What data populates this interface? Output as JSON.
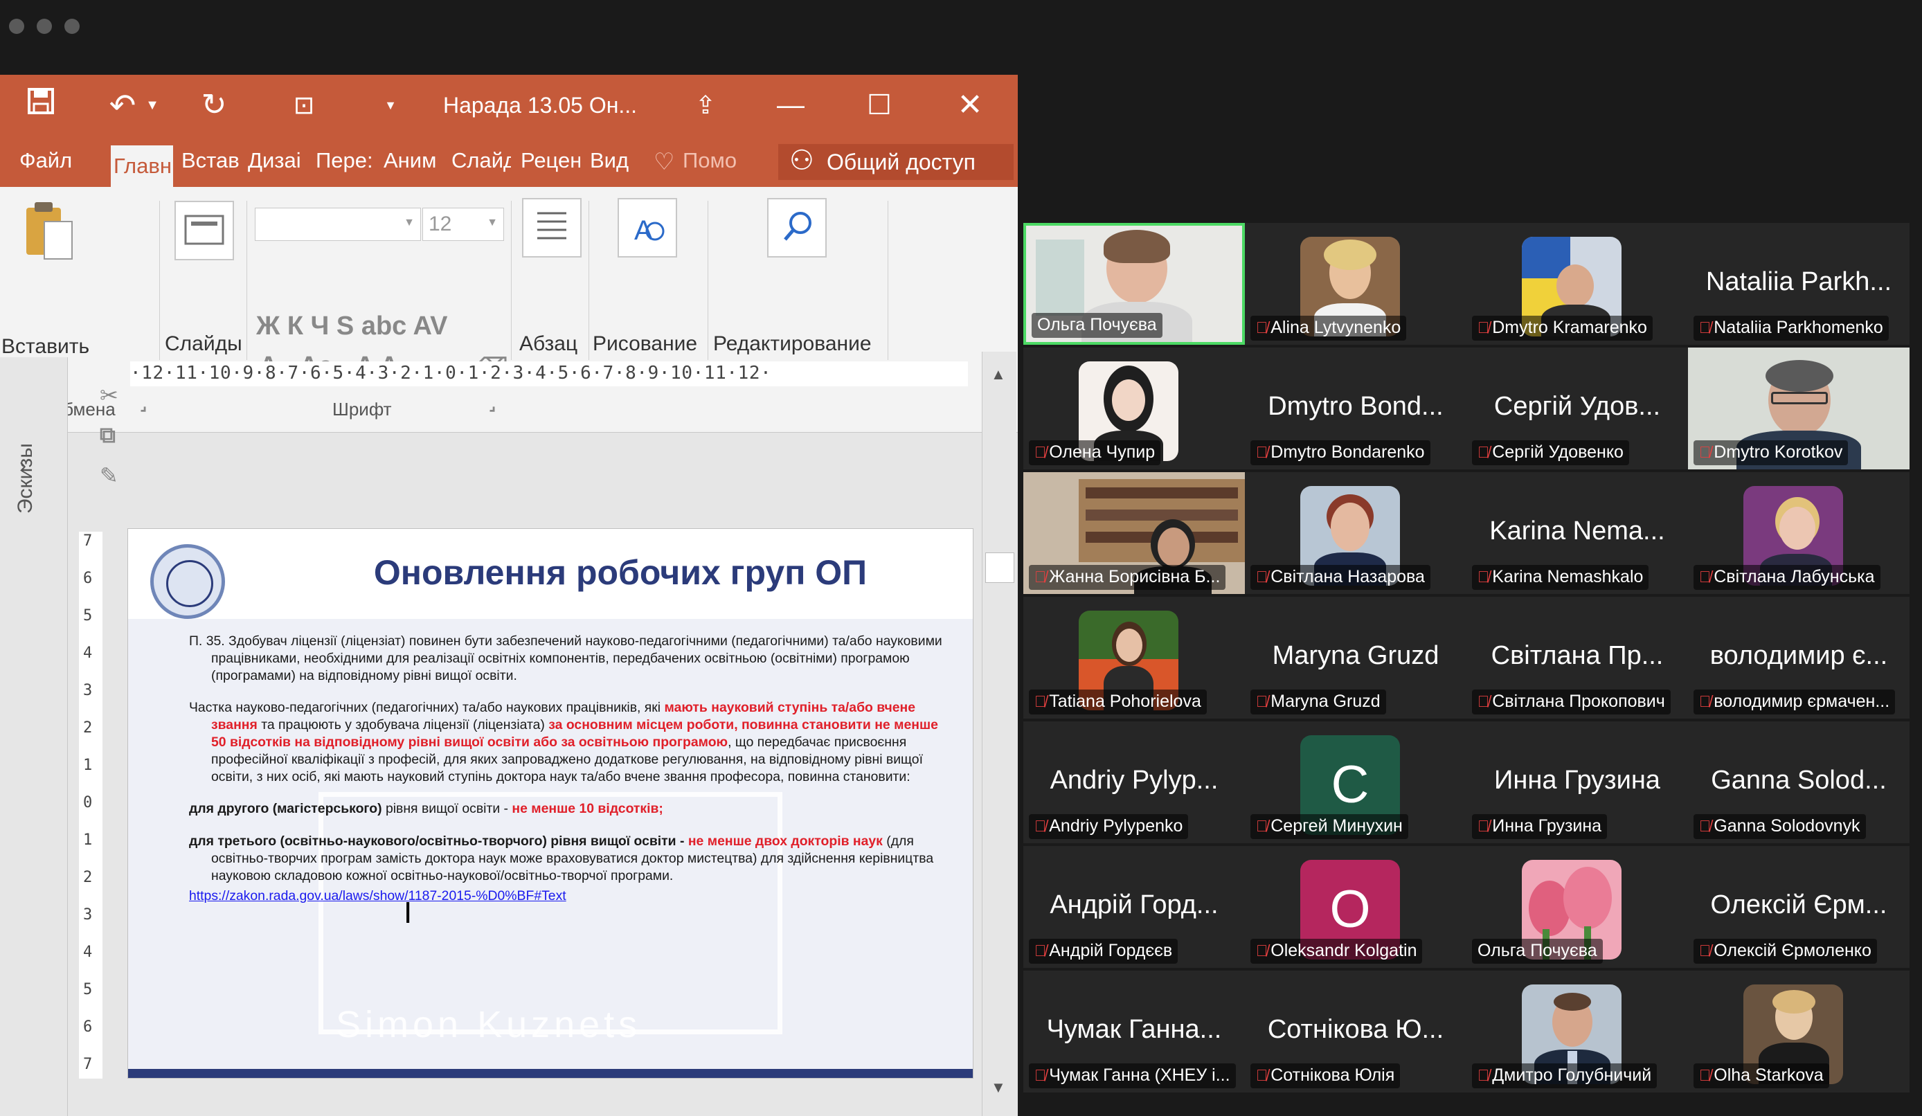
{
  "ppt": {
    "doc_title": "Нарада 13.05 Он...",
    "tabs": [
      "Файл",
      "Главн",
      "Встав",
      "Дизаі",
      "Пере:",
      "Аним",
      "Слайд",
      "Рецен",
      "Вид",
      "Помо"
    ],
    "share": "Общий доступ",
    "ribbon": {
      "paste": "Вставить",
      "slides": "Слайды",
      "paragraph": "Абзац",
      "drawing": "Рисование",
      "editing": "Редактирование",
      "clipboard_group": "Буфер обмена",
      "font_group": "Шрифт",
      "font_size": "12",
      "font_glyphs": "Ж К Ч S abc AV",
      "font_glyphs2": "A · Aa · A A"
    },
    "thumbs_label": "Эскизы",
    "ruler": "·12·11·10·9·8·7·6·5·4·3·2·1·0·1·2·3·4·5·6·7·8·9·10·11·12·",
    "slide": {
      "title": "Оновлення робочих груп ОП",
      "p1": "П. 35. Здобувач ліцензії (ліцензіат) повинен бути забезпечений науково-педагогічними (педагогічними) та/або науковими працівниками, необхідними для реалізації освітніх компонентів, передбачених освітньою (освітніми) програмою (програмами) на відповідному рівні вищої освіти.",
      "p2a": "Частка науково-педагогічних (педагогічних) та/або наукових працівників, які ",
      "p2b": "мають науковий ступінь та/або вчене звання",
      "p2c": " та працюють у здобувача ліцензії (ліцензіата) ",
      "p2d": "за основним місцем роботи, повинна становити не менше 50 відсотків на відповідному рівні вищої освіти або за освітньою програмою",
      "p2e": ", що передбачає присвоєння професійної кваліфікації з професій, для яких запроваджено додаткове регулювання, на відповідному рівні вищої освіти, з них осіб, які мають науковий ступінь доктора наук та/або вчене звання професора, повинна становити:",
      "p3a": "для другого (магістерського)",
      "p3b": " рівня вищої освіти - ",
      "p3c": "не менше 10 відсотків;",
      "p4a": "для третього (освітньо-наукового/освітньо-творчого) рівня вищої освіти - ",
      "p4b": "не менше двох докторів наук",
      "p4c": " (для освітньо-творчих програм замість доктора наук може враховуватися доктор мистецтва) для здійснення керівництва науковою складовою кожної освітньо-наукової/освітньо-творчої програми.",
      "link": "https://zakon.rada.gov.ua/laws/show/1187-2015-%D0%BF#Text",
      "watermark": "Simon Kuznets"
    }
  },
  "participants": [
    {
      "name": "Ольга Почуєва",
      "muted": false,
      "type": "video",
      "active": true
    },
    {
      "name": "Alina Lytvynenko",
      "muted": true,
      "type": "photo"
    },
    {
      "name": "Dmytro Kramarenko",
      "muted": true,
      "type": "photo"
    },
    {
      "name": "Nataliia Parkhomenko",
      "display": "Nataliia Parkh...",
      "muted": true,
      "type": "name"
    },
    {
      "name": "Олена Чупир",
      "muted": true,
      "type": "photo"
    },
    {
      "name": "Dmytro Bondarenko",
      "display": "Dmytro Bond...",
      "muted": true,
      "type": "name"
    },
    {
      "name": "Сергій Удовенко",
      "display": "Сергій Удов...",
      "muted": true,
      "type": "name"
    },
    {
      "name": "Dmytro Korotkov",
      "muted": true,
      "type": "video"
    },
    {
      "name": "Жанна Борисівна Б...",
      "muted": true,
      "type": "video"
    },
    {
      "name": "Світлана Назарова",
      "muted": true,
      "type": "photo"
    },
    {
      "name": "Karina Nemashkalo",
      "display": "Karina Nema...",
      "muted": true,
      "type": "name"
    },
    {
      "name": "Світлана Лабунська",
      "muted": true,
      "type": "photo"
    },
    {
      "name": "Tatiana Pohorielova",
      "muted": true,
      "type": "photo"
    },
    {
      "name": "Maryna Gruzd",
      "display": "Maryna Gruzd",
      "muted": true,
      "type": "name"
    },
    {
      "name": "Світлана Прокопович",
      "display": "Світлана Пр...",
      "muted": true,
      "type": "name"
    },
    {
      "name": "володимир єрмачен...",
      "display": "володимир є...",
      "muted": true,
      "type": "name"
    },
    {
      "name": "Andriy Pylypenko",
      "display": "Andriy Pylyp...",
      "muted": true,
      "type": "name"
    },
    {
      "name": "Сергей Минухин",
      "letter": "C",
      "muted": true,
      "type": "letter",
      "color": "#1f5a45"
    },
    {
      "name": "Инна Грузина",
      "display": "Инна Грузина",
      "muted": true,
      "type": "name"
    },
    {
      "name": "Ganna Solodovnyk",
      "display": "Ganna Solod...",
      "muted": true,
      "type": "name"
    },
    {
      "name": "Андрій Гордєєв",
      "display": "Андрій Горд...",
      "muted": true,
      "type": "name"
    },
    {
      "name": "Oleksandr Kolgatin",
      "letter": "O",
      "muted": true,
      "type": "letter",
      "color": "#b5265e"
    },
    {
      "name": "Ольга Почуєва",
      "muted": false,
      "type": "photo"
    },
    {
      "name": "Олексій Єрмоленко",
      "display": "Олексій Єрм...",
      "muted": true,
      "type": "name"
    },
    {
      "name": "Чумак Ганна (ХНЕУ і...",
      "display": "Чумак Ганна...",
      "muted": true,
      "type": "name"
    },
    {
      "name": "Сотнікова Юлія",
      "display": "Сотнікова Ю...",
      "muted": true,
      "type": "name"
    },
    {
      "name": "Дмитро Голубничий",
      "muted": true,
      "type": "photo"
    },
    {
      "name": "Olha Starkova",
      "muted": true,
      "type": "photo"
    }
  ]
}
